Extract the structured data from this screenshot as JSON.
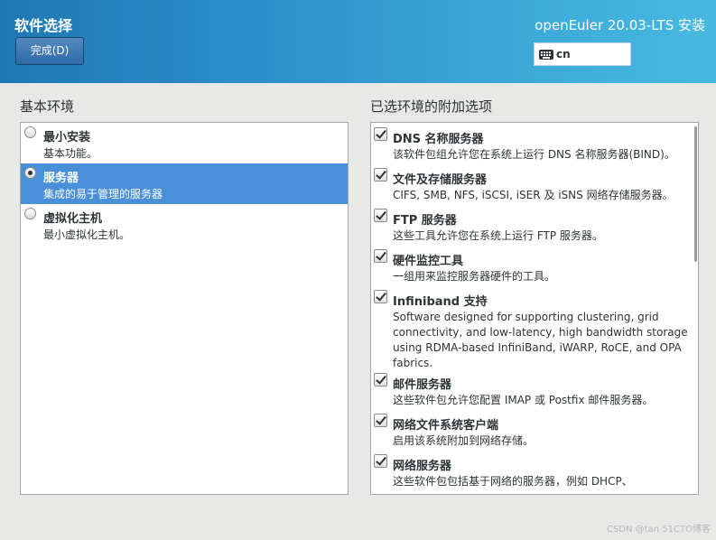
{
  "header": {
    "title": "软件选择",
    "done_label": "完成(D)",
    "product": "openEuler 20.03-LTS 安装",
    "keyboard_layout": "cn"
  },
  "environment": {
    "heading": "基本环境",
    "items": [
      {
        "name": "最小安装",
        "desc": "基本功能。",
        "selected": false
      },
      {
        "name": "服务器",
        "desc": "集成的易于管理的服务器",
        "selected": true
      },
      {
        "name": "虚拟化主机",
        "desc": "最小虚拟化主机。",
        "selected": false
      }
    ]
  },
  "addons": {
    "heading": "已选环境的附加选项",
    "items": [
      {
        "name": "DNS 名称服务器",
        "desc": "该软件包组允许您在系统上运行 DNS 名称服务器(BIND)。",
        "checked": true
      },
      {
        "name": "文件及存储服务器",
        "desc": "CIFS, SMB, NFS, iSCSI, iSER 及 iSNS 网络存储服务器。",
        "checked": true
      },
      {
        "name": "FTP 服务器",
        "desc": "这些工具允许您在系统上运行 FTP 服务器。",
        "checked": true
      },
      {
        "name": "硬件监控工具",
        "desc": "一组用来监控服务器硬件的工具。",
        "checked": true
      },
      {
        "name": "Infiniband 支持",
        "desc": "Software designed for supporting clustering, grid connectivity, and low-latency, high bandwidth storage using RDMA-based InfiniBand, iWARP, RoCE, and OPA fabrics.",
        "checked": true
      },
      {
        "name": "邮件服务器",
        "desc": "这些软件包允许您配置 IMAP 或 Postfix 邮件服务器。",
        "checked": true
      },
      {
        "name": "网络文件系统客户端",
        "desc": "启用该系统附加到网络存储。",
        "checked": true
      },
      {
        "name": "网络服务器",
        "desc": "这些软件包包括基于网络的服务器，例如 DHCP、",
        "checked": true
      }
    ]
  },
  "watermark": "CSDN @tan 51CTO博客"
}
